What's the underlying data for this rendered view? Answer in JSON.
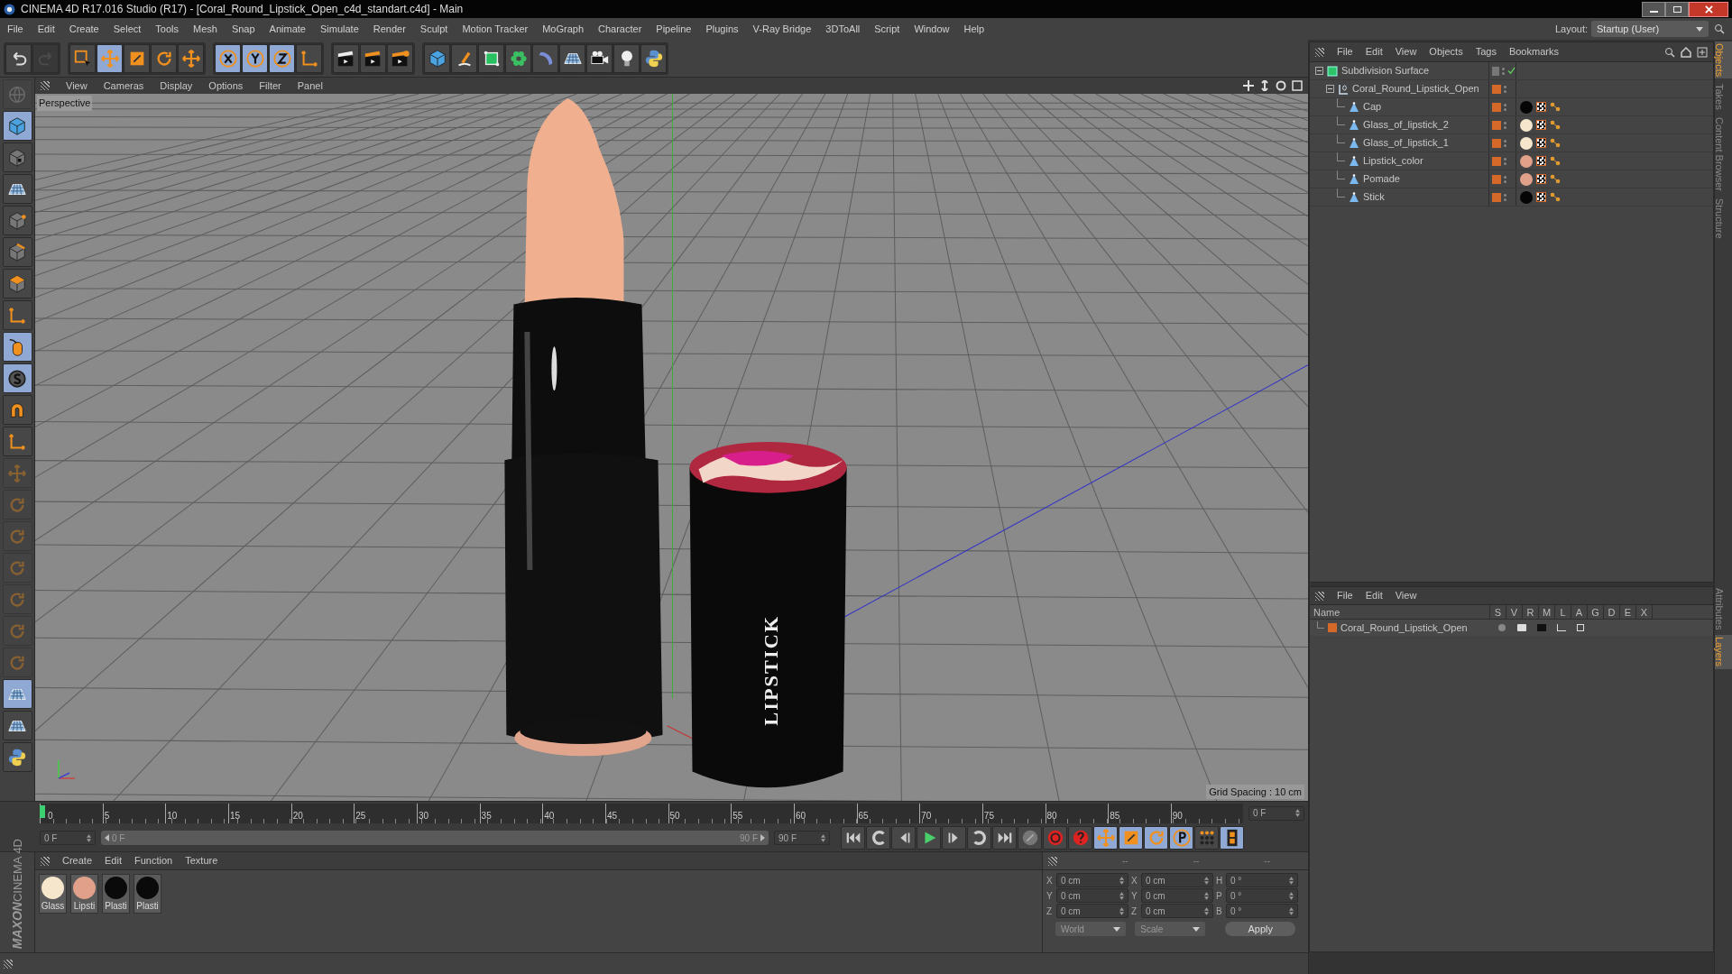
{
  "window": {
    "title": "CINEMA 4D R17.016 Studio (R17) - [Coral_Round_Lipstick_Open_c4d_standart.c4d] - Main"
  },
  "menu_bar": [
    "File",
    "Edit",
    "Create",
    "Select",
    "Tools",
    "Mesh",
    "Snap",
    "Animate",
    "Simulate",
    "Render",
    "Sculpt",
    "Motion Tracker",
    "MoGraph",
    "Character",
    "Pipeline",
    "Plugins",
    "V-Ray Bridge",
    "3DToAll",
    "Script",
    "Window",
    "Help"
  ],
  "layout": {
    "label": "Layout:",
    "value": "Startup (User)"
  },
  "toolbar_groups": [
    {
      "tools": [
        {
          "kind": "undo",
          "selected": false,
          "disabled": false
        },
        {
          "kind": "redo",
          "selected": false,
          "disabled": true
        }
      ]
    },
    {
      "tools": [
        {
          "kind": "select",
          "selected": false,
          "disabled": false
        },
        {
          "kind": "move",
          "selected": true,
          "disabled": false
        },
        {
          "kind": "scale",
          "selected": false,
          "disabled": false
        },
        {
          "kind": "rotate",
          "selected": false,
          "disabled": false
        },
        {
          "kind": "move",
          "selected": false,
          "disabled": false
        }
      ]
    },
    {
      "tools": [
        {
          "kind": "axis-x",
          "selected": true,
          "disabled": false
        },
        {
          "kind": "axis-y",
          "selected": true,
          "disabled": false
        },
        {
          "kind": "axis-z",
          "selected": true,
          "disabled": false
        },
        {
          "kind": "coords",
          "selected": false,
          "disabled": false
        }
      ]
    },
    {
      "tools": [
        {
          "kind": "render-view",
          "selected": false,
          "disabled": false
        },
        {
          "kind": "render",
          "selected": false,
          "disabled": false
        },
        {
          "kind": "render-settings",
          "selected": false,
          "disabled": false
        }
      ]
    },
    {
      "tools": [
        {
          "kind": "cube",
          "selected": false,
          "disabled": false
        },
        {
          "kind": "pen",
          "selected": false,
          "disabled": false
        },
        {
          "kind": "subdivision",
          "selected": false,
          "disabled": false
        },
        {
          "kind": "cloner",
          "selected": false,
          "disabled": false
        },
        {
          "kind": "deformer",
          "selected": false,
          "disabled": false
        },
        {
          "kind": "floor",
          "selected": false,
          "disabled": false
        },
        {
          "kind": "camera",
          "selected": false,
          "disabled": false
        },
        {
          "kind": "light",
          "selected": false,
          "disabled": false
        },
        {
          "kind": "python",
          "selected": false,
          "disabled": false
        }
      ]
    }
  ],
  "left_tools": [
    {
      "kind": "globe",
      "selected": false,
      "disabled": true
    },
    {
      "kind": "cube",
      "selected": true,
      "disabled": false
    },
    {
      "kind": "checker",
      "selected": false,
      "disabled": false
    },
    {
      "kind": "floor",
      "selected": false,
      "disabled": false
    },
    {
      "kind": "points",
      "selected": false,
      "disabled": false
    },
    {
      "kind": "edges",
      "selected": false,
      "disabled": false
    },
    {
      "kind": "polygons",
      "selected": false,
      "disabled": false
    },
    {
      "kind": "axis",
      "selected": false,
      "disabled": false
    },
    {
      "kind": "mouse",
      "selected": true,
      "disabled": false
    },
    {
      "kind": "snap",
      "selected": true,
      "disabled": false
    },
    {
      "kind": "magnet",
      "selected": false,
      "disabled": false
    },
    {
      "kind": "axis",
      "selected": false,
      "disabled": false
    },
    {
      "kind": "move",
      "selected": false,
      "disabled": true
    },
    {
      "kind": "rotate",
      "selected": false,
      "disabled": true
    },
    {
      "kind": "rotate",
      "selected": false,
      "disabled": true
    },
    {
      "kind": "rotate",
      "selected": false,
      "disabled": true
    },
    {
      "kind": "rotate",
      "selected": false,
      "disabled": true
    },
    {
      "kind": "rotate",
      "selected": false,
      "disabled": true
    },
    {
      "kind": "rotate",
      "selected": false,
      "disabled": true
    },
    {
      "kind": "floor",
      "selected": true,
      "disabled": false
    },
    {
      "kind": "floor",
      "selected": false,
      "disabled": false
    },
    {
      "kind": "python",
      "selected": false,
      "disabled": false
    }
  ],
  "brand": {
    "line_1": "MAXON",
    "line_2": "CINEMA 4D"
  },
  "viewport": {
    "menu": [
      "View",
      "Cameras",
      "Display",
      "Options",
      "Filter",
      "Panel"
    ],
    "camera": "Perspective",
    "grid_spacing": "Grid Spacing : 10 cm",
    "cap_text": "LIPSTICK"
  },
  "timeline": {
    "ticks": [
      "0",
      "5",
      "10",
      "15",
      "20",
      "25",
      "30",
      "35",
      "40",
      "45",
      "50",
      "55",
      "60",
      "65",
      "70",
      "75",
      "80",
      "85",
      "90"
    ],
    "current_frame": "0 F",
    "start": "0 F",
    "range": {
      "start": "0 F",
      "end": "90 F",
      "level": 1
    },
    "end": "90 F"
  },
  "transport": [
    {
      "kind": "first",
      "selected": false
    },
    {
      "kind": "prev-key",
      "selected": false
    },
    {
      "kind": "prev",
      "selected": false
    },
    {
      "kind": "play",
      "selected": false
    },
    {
      "kind": "next",
      "selected": false
    },
    {
      "kind": "next-key",
      "selected": false
    },
    {
      "kind": "last",
      "selected": false
    },
    {
      "kind": "keyframe",
      "selected": false
    },
    {
      "kind": "record",
      "selected": false
    },
    {
      "kind": "help",
      "selected": false
    },
    {
      "kind": "move",
      "selected": true
    },
    {
      "kind": "scale",
      "selected": true
    },
    {
      "kind": "rotate",
      "selected": true
    },
    {
      "kind": "param",
      "selected": true
    },
    {
      "kind": "dots",
      "selected": false
    },
    {
      "kind": "film",
      "selected": true
    }
  ],
  "material_manager": {
    "menu": [
      "Create",
      "Edit",
      "Function",
      "Texture"
    ],
    "materials": [
      {
        "name": "Glass",
        "color": "#f6e6cc"
      },
      {
        "name": "Lipsti",
        "color": "#e0a08a"
      },
      {
        "name": "Plasti",
        "color": "#0a0a0a"
      },
      {
        "name": "Plasti",
        "color": "#0a0a0a"
      }
    ]
  },
  "coordinates": {
    "headers": [
      "--",
      "--",
      "--"
    ],
    "columns": [
      {
        "rows": [
          {
            "label": "X",
            "value": "0 cm"
          },
          {
            "label": "Y",
            "value": "0 cm"
          },
          {
            "label": "Z",
            "value": "0 cm"
          }
        ]
      },
      {
        "rows": [
          {
            "label": "X",
            "value": "0 cm"
          },
          {
            "label": "Y",
            "value": "0 cm"
          },
          {
            "label": "Z",
            "value": "0 cm"
          }
        ]
      },
      {
        "rows": [
          {
            "label": "H",
            "value": "0 °"
          },
          {
            "label": "P",
            "value": "0 °"
          },
          {
            "label": "B",
            "value": "0 °"
          }
        ]
      }
    ],
    "dropdowns": [
      "World",
      "Scale"
    ],
    "apply": "Apply"
  },
  "object_manager": {
    "menu": [
      "File",
      "Edit",
      "View",
      "Objects",
      "Tags",
      "Bookmarks"
    ],
    "tree": [
      {
        "name": "Subdivision Surface",
        "kind": "subdivision",
        "expanded": true,
        "enabled": true,
        "children": [
          {
            "name": "Coral_Round_Lipstick_Open",
            "kind": "null",
            "expanded": true,
            "children": [
              {
                "name": "Cap",
                "kind": "polygon",
                "color": "#050505"
              },
              {
                "name": "Glass_of_lipstick_2",
                "kind": "polygon",
                "color": "#f6e6cc"
              },
              {
                "name": "Glass_of_lipstick_1",
                "kind": "polygon",
                "color": "#f6e6cc"
              },
              {
                "name": "Lipstick_color",
                "kind": "polygon",
                "color": "#e0a08a"
              },
              {
                "name": "Pomade",
                "kind": "polygon",
                "color": "#e0a08a"
              },
              {
                "name": "Stick",
                "kind": "polygon",
                "color": "#050505"
              }
            ]
          }
        ]
      }
    ]
  },
  "side_tabs": [
    {
      "label": "Objects",
      "selected": true
    },
    {
      "label": "Takes",
      "selected": false
    },
    {
      "label": "Content Browser",
      "selected": false
    },
    {
      "label": "Structure",
      "selected": false
    }
  ],
  "side_tabs_lower": [
    {
      "label": "Attributes",
      "selected": false
    },
    {
      "label": "Layers",
      "selected": true
    }
  ],
  "layer_manager": {
    "menu": [
      "File",
      "Edit",
      "View"
    ],
    "columns": [
      "Name",
      "S",
      "V",
      "R",
      "M",
      "L",
      "A",
      "G",
      "D",
      "E",
      "X"
    ],
    "rows": [
      {
        "name": "Coral_Round_Lipstick_Open",
        "color": "#d4692a"
      }
    ]
  }
}
